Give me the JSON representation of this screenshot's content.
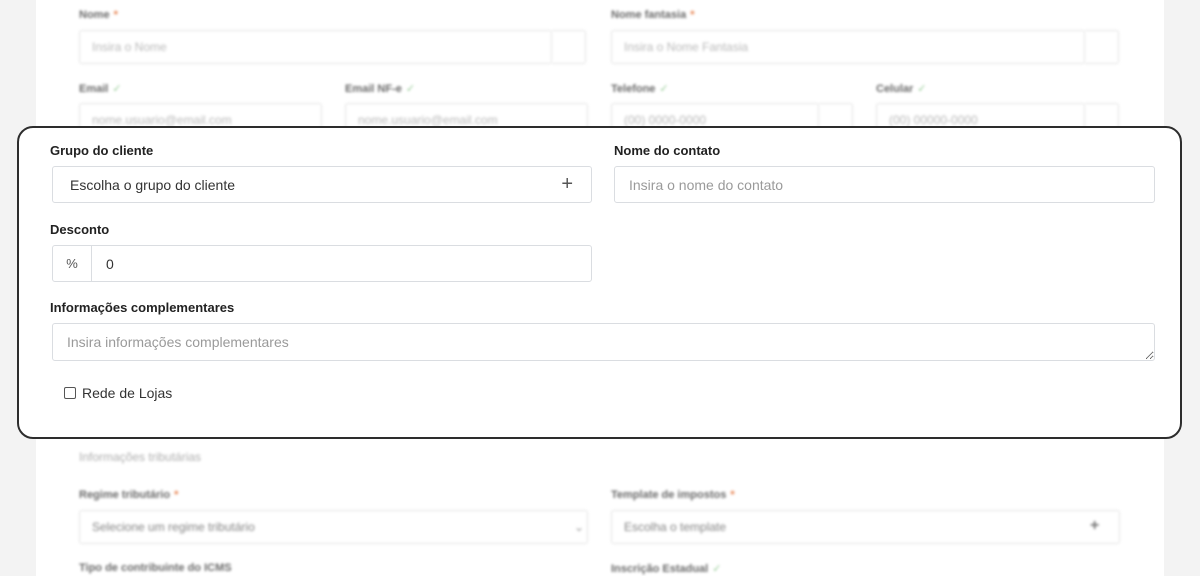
{
  "background_form": {
    "top": {
      "nome": {
        "label": "Nome",
        "placeholder": "Insira o Nome"
      },
      "nome_fantasia": {
        "label": "Nome fantasia",
        "placeholder": "Insira o Nome Fantasia"
      },
      "email": {
        "label": "Email",
        "placeholder": "nome.usuario@email.com"
      },
      "email_nfe": {
        "label": "Email NF-e",
        "placeholder": "nome.usuario@email.com"
      },
      "telefone": {
        "label": "Telefone",
        "placeholder": "(00) 0000-0000"
      },
      "celular": {
        "label": "Celular",
        "placeholder": "(00) 00000-0000"
      },
      "required_mark": "*",
      "ok_mark": "✓"
    },
    "tax_section": {
      "title": "Informações tributárias",
      "regime": {
        "label": "Regime tributário",
        "value": "Selecione um regime tributário"
      },
      "template": {
        "label": "Template de impostos",
        "value": "Escolha o template"
      },
      "tipo_contribuinte": {
        "label": "Tipo de contribuinte do ICMS"
      },
      "inscricao": {
        "label": "Inscrição Estadual"
      }
    }
  },
  "panel": {
    "grupo_cliente": {
      "label": "Grupo do cliente",
      "value": "Escolha o grupo do cliente",
      "add_glyph": "+"
    },
    "nome_contato": {
      "label": "Nome do contato",
      "placeholder": "Insira o nome do contato"
    },
    "desconto": {
      "label": "Desconto",
      "addon": "%",
      "value": "0"
    },
    "informacoes": {
      "label": "Informações complementares",
      "placeholder": "Insira informações complementares"
    },
    "rede_lojas": {
      "label": "Rede de Lojas",
      "checked": false
    }
  }
}
